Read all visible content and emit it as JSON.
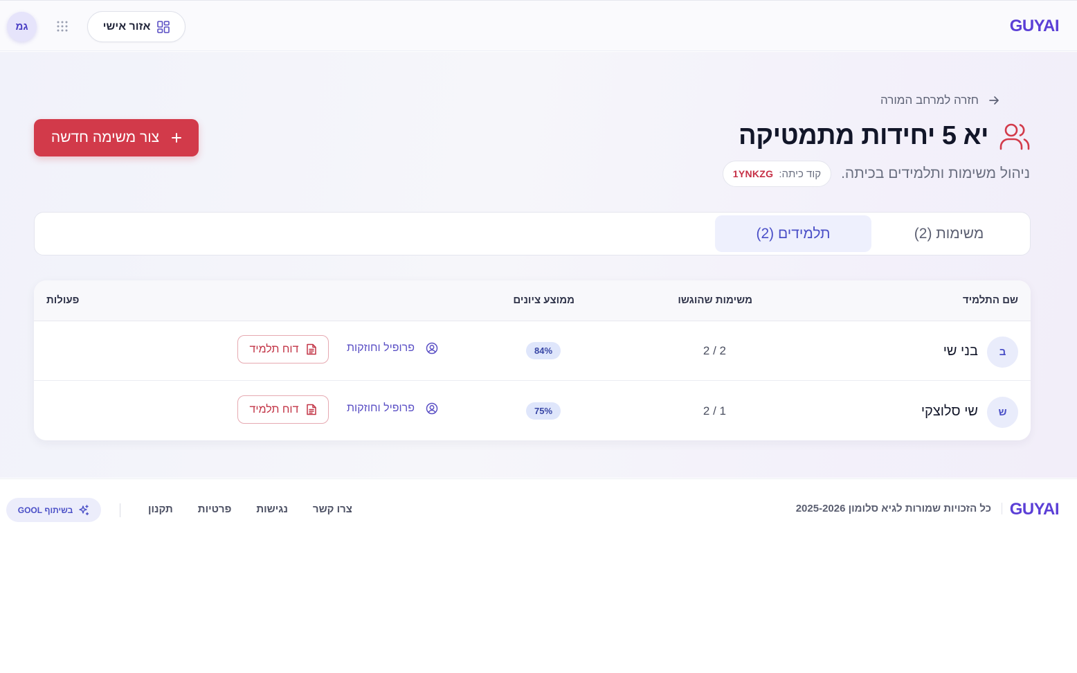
{
  "header": {
    "logo": "GUYAI",
    "personal_area_label": "אזור אישי",
    "avatar_initials": "גמ"
  },
  "page": {
    "back_label": "חזרה למרחב המורה",
    "title": "יא 5 יחידות מתמטיקה",
    "subtitle": "ניהול משימות ותלמידים בכיתה.",
    "class_code_label": "קוד כיתה:",
    "class_code_value": "1YNKZG",
    "new_task_label": "צור משימה חדשה"
  },
  "tabs": [
    {
      "label": "משימות (2)",
      "active": false
    },
    {
      "label": "תלמידים (2)",
      "active": true
    }
  ],
  "table": {
    "columns": [
      "שם התלמיד",
      "משימות שהוגשו",
      "ממוצע ציונים",
      "פעולות"
    ],
    "rows": [
      {
        "initial": "ב",
        "name": "בני שי",
        "submitted": "2 / 2",
        "average": "84%",
        "profile_label": "פרופיל וחוזקות",
        "report_label": "דוח תלמיד"
      },
      {
        "initial": "ש",
        "name": "שי סלוצקי",
        "submitted": "1 / 2",
        "average": "75%",
        "profile_label": "פרופיל וחוזקות",
        "report_label": "דוח תלמיד"
      }
    ]
  },
  "footer": {
    "logo": "GUYAI",
    "copyright": "כל הזכויות שמורות לגיא סלומון 2025-2026",
    "links": [
      "צרו קשר",
      "נגישות",
      "פרטיות",
      "תקנון"
    ],
    "badge": "בשיתוף GOOL"
  },
  "colors": {
    "brand": "#5b3fd6",
    "accent_red": "#d23a4a",
    "active_tab_bg": "#eef0fd"
  },
  "icons": [
    "grid-dashboard-icon",
    "apps-grid-icon",
    "arrow-right-icon",
    "users-icon",
    "plus-icon",
    "user-circle-icon",
    "document-icon",
    "sparkles-icon"
  ]
}
